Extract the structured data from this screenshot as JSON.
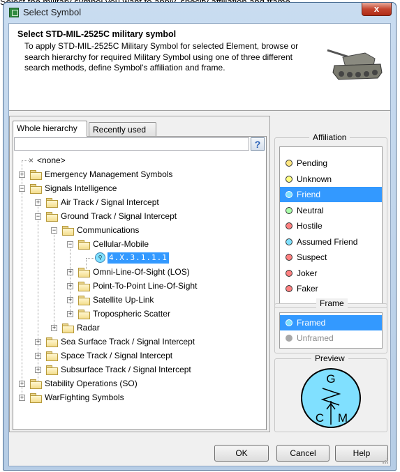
{
  "caption": "Select the military symbol you want to apply, specify affiliation and frame.",
  "window": {
    "title": "Select Symbol",
    "close_label": "x"
  },
  "header": {
    "title": "Select STD-MIL-2525C military symbol",
    "description": "To apply STD-MIL-2525C Military Symbol for selected Element, browse or search hierarchy for required Military Symbol using one of three different search methods, define Symbol's affiliation and frame."
  },
  "tabs": [
    {
      "label": "Whole hierarchy"
    },
    {
      "label": "Recently used"
    }
  ],
  "search": {
    "value": "",
    "help_label": "?"
  },
  "tree": [
    {
      "label": "<none>"
    },
    {
      "label": "Emergency Management Symbols"
    },
    {
      "label": "Signals Intelligence"
    },
    {
      "label": "Air Track / Signal Intercept"
    },
    {
      "label": "Ground Track / Signal Intercept"
    },
    {
      "label": "Communications"
    },
    {
      "label": "Cellular-Mobile"
    },
    {
      "label": "4.X.3.1.1.1"
    },
    {
      "label": "Omni-Line-Of-Sight (LOS)"
    },
    {
      "label": "Point-To-Point Line-Of-Sight"
    },
    {
      "label": "Satellite Up-Link"
    },
    {
      "label": "Tropospheric Scatter"
    },
    {
      "label": "Radar"
    },
    {
      "label": "Sea Surface Track / Signal Intercept"
    },
    {
      "label": "Space Track / Signal Intercept"
    },
    {
      "label": "Subsurface Track / Signal Intercept"
    },
    {
      "label": "Stability Operations (SO)"
    },
    {
      "label": "WarFighting Symbols"
    }
  ],
  "affiliation": {
    "title": "Affiliation",
    "items": [
      {
        "label": "Pending",
        "color": "#ffe680"
      },
      {
        "label": "Unknown",
        "color": "#ffff80"
      },
      {
        "label": "Friend",
        "color": "#80e0ff"
      },
      {
        "label": "Neutral",
        "color": "#aaffaa"
      },
      {
        "label": "Hostile",
        "color": "#ff8080"
      },
      {
        "label": "Assumed Friend",
        "color": "#80e0ff"
      },
      {
        "label": "Suspect",
        "color": "#ff8080"
      },
      {
        "label": "Joker",
        "color": "#ff8080"
      },
      {
        "label": "Faker",
        "color": "#ff8080"
      }
    ],
    "selected": "Friend"
  },
  "frame": {
    "title": "Frame",
    "items": [
      {
        "label": "Framed"
      },
      {
        "label": "Unframed"
      }
    ],
    "selected": "Framed"
  },
  "preview": {
    "title": "Preview",
    "top_letter": "G",
    "left_letter": "C",
    "right_letter": "M"
  },
  "buttons": {
    "ok": "OK",
    "cancel": "Cancel",
    "help": "Help"
  },
  "colors": {
    "selection": "#3399ff",
    "friend_fill": "#80e0ff"
  }
}
